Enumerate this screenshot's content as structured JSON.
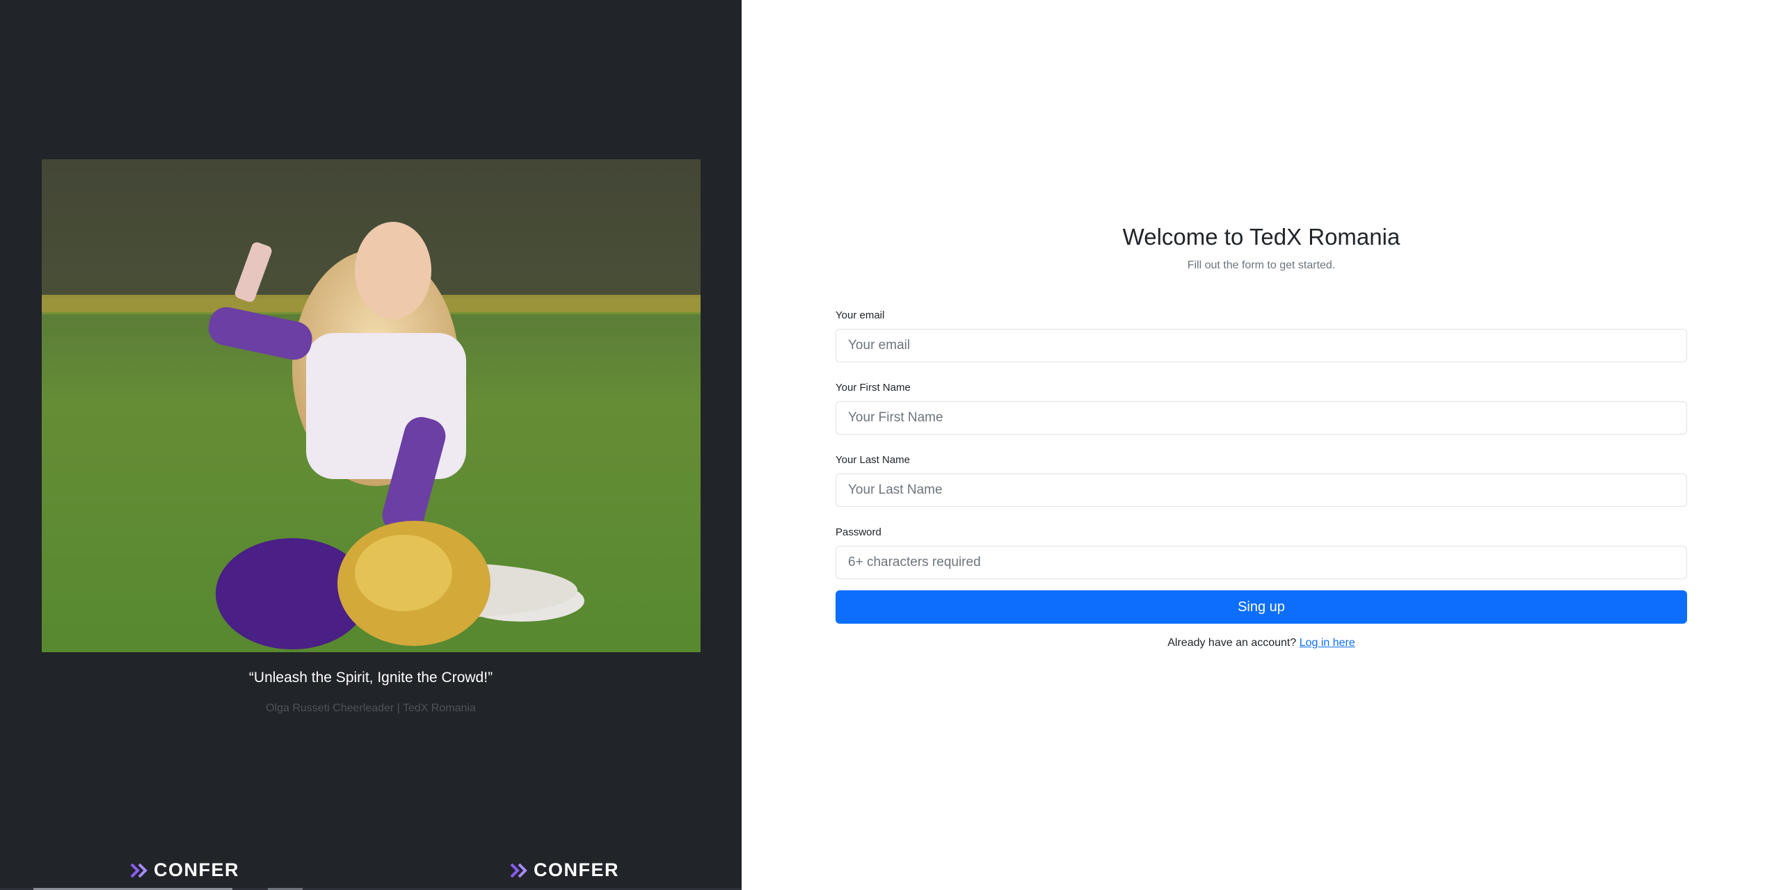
{
  "hero": {
    "quote": "“Unleash the Spirit, Ignite the Crowd!”",
    "credit": "Olga Russeti Cheerleader | TedX Romania",
    "photo_description": "cheerleader-selfie-photo"
  },
  "brand": {
    "logo_text": "CONFER",
    "accent_color": "#8b5cf6"
  },
  "form": {
    "title": "Welcome to TedX Romania",
    "subtitle": "Fill out the form to get started.",
    "fields": [
      {
        "label": "Your email",
        "placeholder": "Your email",
        "value": ""
      },
      {
        "label": "Your First Name",
        "placeholder": "Your First Name",
        "value": ""
      },
      {
        "label": "Your Last Name",
        "placeholder": "Your Last Name",
        "value": ""
      },
      {
        "label": "Password",
        "placeholder": "6+ characters required",
        "value": ""
      }
    ],
    "submit_label": "Sing up",
    "login_prompt": "Already have an account?",
    "login_link": "Log in here"
  },
  "colors": {
    "left_bg": "#212429",
    "primary": "#0d6efd"
  }
}
